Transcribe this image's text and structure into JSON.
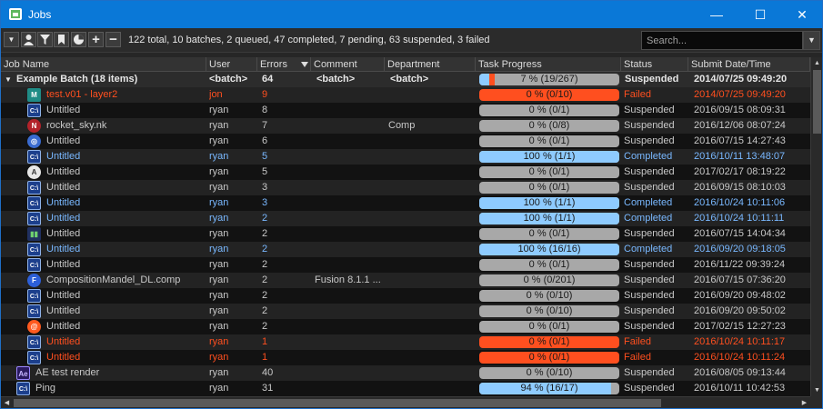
{
  "window": {
    "title": "Jobs",
    "minimize": "—",
    "maximize": "☐",
    "close": "✕"
  },
  "toolbar": {
    "summary": "122 total, 10 batches, 2 queued, 47 completed, 7 pending, 63 suspended, 3 failed",
    "search_placeholder": "Search...",
    "buttons": [
      "dropdown",
      "user-filter",
      "filter",
      "bookmark",
      "pie-chart",
      "add",
      "remove"
    ]
  },
  "columns": [
    "Job Name",
    "User",
    "Errors",
    "Comment",
    "Department",
    "Task Progress",
    "Status",
    "Submit Date/Time"
  ],
  "colors": {
    "failed_text": "#ff4f1f",
    "completed_text": "#79b8ff",
    "failed_bar": "#ff4f1f",
    "completed_bar": "#8ecbff",
    "empty_bar": "#a8a8a8"
  },
  "batch": {
    "name": "Example Batch (18 items)",
    "user": "<batch>",
    "errors": "64",
    "comment": "<batch>",
    "department": "<batch>",
    "progress_text": "7 %  (19/267)",
    "progress": 0.07,
    "failed_fraction": 0.04,
    "status": "Suspended",
    "date": "2014/07/25 09:49:20"
  },
  "rows": [
    {
      "icon": "mantra",
      "name": "test.v01 - layer2",
      "user": "jon",
      "errors": "9",
      "comment": "",
      "department": "",
      "progress_text": "0 %   (0/10)",
      "progress": 0,
      "status": "Failed",
      "date": "2014/07/25 09:49:20",
      "state": "failed",
      "indent": 1
    },
    {
      "icon": "cmd",
      "name": "Untitled",
      "user": "ryan",
      "errors": "8",
      "comment": "",
      "department": "",
      "progress_text": "0 %   (0/1)",
      "progress": 0,
      "status": "Suspended",
      "date": "2016/09/15 08:09:31",
      "state": "normal",
      "indent": 1
    },
    {
      "icon": "nuke",
      "name": "rocket_sky.nk",
      "user": "ryan",
      "errors": "7",
      "comment": "",
      "department": "Comp",
      "progress_text": "0 %   (0/8)",
      "progress": 0,
      "status": "Suspended",
      "date": "2016/12/06 08:07:24",
      "state": "normal",
      "indent": 1
    },
    {
      "icon": "c4d",
      "name": "Untitled",
      "user": "ryan",
      "errors": "6",
      "comment": "",
      "department": "",
      "progress_text": "0 %   (0/1)",
      "progress": 0,
      "status": "Suspended",
      "date": "2016/07/15 14:27:43",
      "state": "normal",
      "indent": 1
    },
    {
      "icon": "cmd",
      "name": "Untitled",
      "user": "ryan",
      "errors": "5",
      "comment": "",
      "department": "",
      "progress_text": "100 %   (1/1)",
      "progress": 1,
      "status": "Completed",
      "date": "2016/10/11 13:48:07",
      "state": "completed",
      "indent": 1
    },
    {
      "icon": "arnold",
      "name": "Untitled",
      "user": "ryan",
      "errors": "5",
      "comment": "",
      "department": "",
      "progress_text": "0 %   (0/1)",
      "progress": 0,
      "status": "Suspended",
      "date": "2017/02/17 08:19:22",
      "state": "normal",
      "indent": 1
    },
    {
      "icon": "cmd",
      "name": "Untitled",
      "user": "ryan",
      "errors": "3",
      "comment": "",
      "department": "",
      "progress_text": "0 %   (0/1)",
      "progress": 0,
      "status": "Suspended",
      "date": "2016/09/15 08:10:03",
      "state": "normal",
      "indent": 1
    },
    {
      "icon": "cmd",
      "name": "Untitled",
      "user": "ryan",
      "errors": "3",
      "comment": "",
      "department": "",
      "progress_text": "100 %   (1/1)",
      "progress": 1,
      "status": "Completed",
      "date": "2016/10/24 10:11:06",
      "state": "completed",
      "indent": 1
    },
    {
      "icon": "cmd",
      "name": "Untitled",
      "user": "ryan",
      "errors": "2",
      "comment": "",
      "department": "",
      "progress_text": "100 %   (1/1)",
      "progress": 1,
      "status": "Completed",
      "date": "2016/10/24 10:11:11",
      "state": "completed",
      "indent": 1
    },
    {
      "icon": "bars",
      "name": "Untitled",
      "user": "ryan",
      "errors": "2",
      "comment": "",
      "department": "",
      "progress_text": "0 %   (0/1)",
      "progress": 0,
      "status": "Suspended",
      "date": "2016/07/15 14:04:34",
      "state": "normal",
      "indent": 1
    },
    {
      "icon": "cmd",
      "name": "Untitled",
      "user": "ryan",
      "errors": "2",
      "comment": "",
      "department": "",
      "progress_text": "100 %   (16/16)",
      "progress": 1,
      "status": "Completed",
      "date": "2016/09/20 09:18:05",
      "state": "completed",
      "indent": 1
    },
    {
      "icon": "cmd",
      "name": "Untitled",
      "user": "ryan",
      "errors": "2",
      "comment": "",
      "department": "",
      "progress_text": "0 %   (0/1)",
      "progress": 0,
      "status": "Suspended",
      "date": "2016/11/22 09:39:24",
      "state": "normal",
      "indent": 1
    },
    {
      "icon": "fusion",
      "name": "CompositionMandel_DL.comp",
      "user": "ryan",
      "errors": "2",
      "comment": "Fusion 8.1.1 ...",
      "department": "",
      "progress_text": "0 %   (0/201)",
      "progress": 0,
      "status": "Suspended",
      "date": "2016/07/15 07:36:20",
      "state": "normal",
      "indent": 1
    },
    {
      "icon": "cmd",
      "name": "Untitled",
      "user": "ryan",
      "errors": "2",
      "comment": "",
      "department": "",
      "progress_text": "0 %   (0/10)",
      "progress": 0,
      "status": "Suspended",
      "date": "2016/09/20 09:48:02",
      "state": "normal",
      "indent": 1
    },
    {
      "icon": "cmd",
      "name": "Untitled",
      "user": "ryan",
      "errors": "2",
      "comment": "",
      "department": "",
      "progress_text": "0 %   (0/10)",
      "progress": 0,
      "status": "Suspended",
      "date": "2016/09/20 09:50:02",
      "state": "normal",
      "indent": 1
    },
    {
      "icon": "houdini",
      "name": "Untitled",
      "user": "ryan",
      "errors": "2",
      "comment": "",
      "department": "",
      "progress_text": "0 %   (0/1)",
      "progress": 0,
      "status": "Suspended",
      "date": "2017/02/15 12:27:23",
      "state": "normal",
      "indent": 1
    },
    {
      "icon": "cmd",
      "name": "Untitled",
      "user": "ryan",
      "errors": "1",
      "comment": "",
      "department": "",
      "progress_text": "0 %   (0/1)",
      "progress": 0,
      "status": "Failed",
      "date": "2016/10/24 10:11:17",
      "state": "failed",
      "indent": 1
    },
    {
      "icon": "cmd",
      "name": "Untitled",
      "user": "ryan",
      "errors": "1",
      "comment": "",
      "department": "",
      "progress_text": "0 %   (0/1)",
      "progress": 0,
      "status": "Failed",
      "date": "2016/10/24 10:11:24",
      "state": "failed",
      "indent": 1
    },
    {
      "icon": "ae",
      "name": "AE test render",
      "user": "ryan",
      "errors": "40",
      "comment": "",
      "department": "",
      "progress_text": "0 %   (0/10)",
      "progress": 0,
      "status": "Suspended",
      "date": "2016/08/05 09:13:44",
      "state": "normal",
      "indent": 0
    },
    {
      "icon": "cmd",
      "name": "Ping",
      "user": "ryan",
      "errors": "31",
      "comment": "",
      "department": "",
      "progress_text": "94 %   (16/17)",
      "progress": 0.94,
      "status": "Suspended",
      "date": "2016/10/11 10:42:53",
      "state": "normal",
      "indent": 0
    }
  ]
}
